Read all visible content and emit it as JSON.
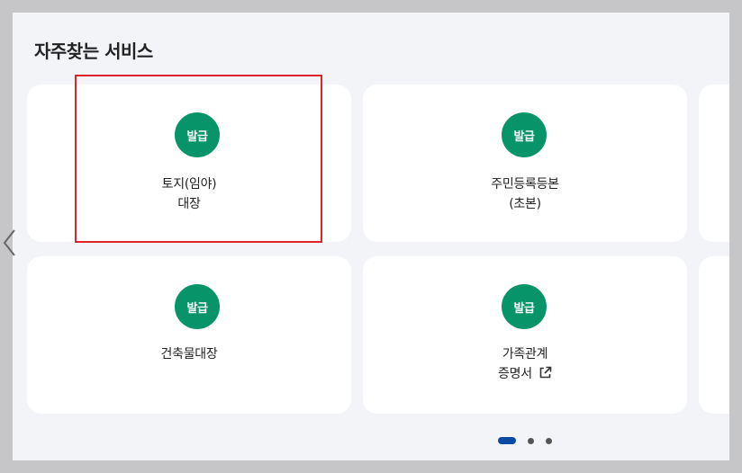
{
  "section_title": "자주찾는 서비스",
  "cards": [
    {
      "badge": "발급",
      "line1": "토지(임야)",
      "line2": "대장",
      "external": false
    },
    {
      "badge": "발급",
      "line1": "주민등록등본",
      "line2": "(초본)",
      "external": false
    },
    {
      "badge": "발급",
      "line1": "건축물대장",
      "line2": "",
      "external": false
    },
    {
      "badge": "발급",
      "line1": "가족관계",
      "line2": "증명서",
      "external": true
    }
  ],
  "pagination": {
    "pages": 3,
    "active": 1
  },
  "colors": {
    "badge": "#069468",
    "highlight": "#e0222a",
    "active_dot": "#0b4aa2"
  },
  "icons": {
    "prev": "chevron-left-icon",
    "external": "external-link-icon"
  }
}
